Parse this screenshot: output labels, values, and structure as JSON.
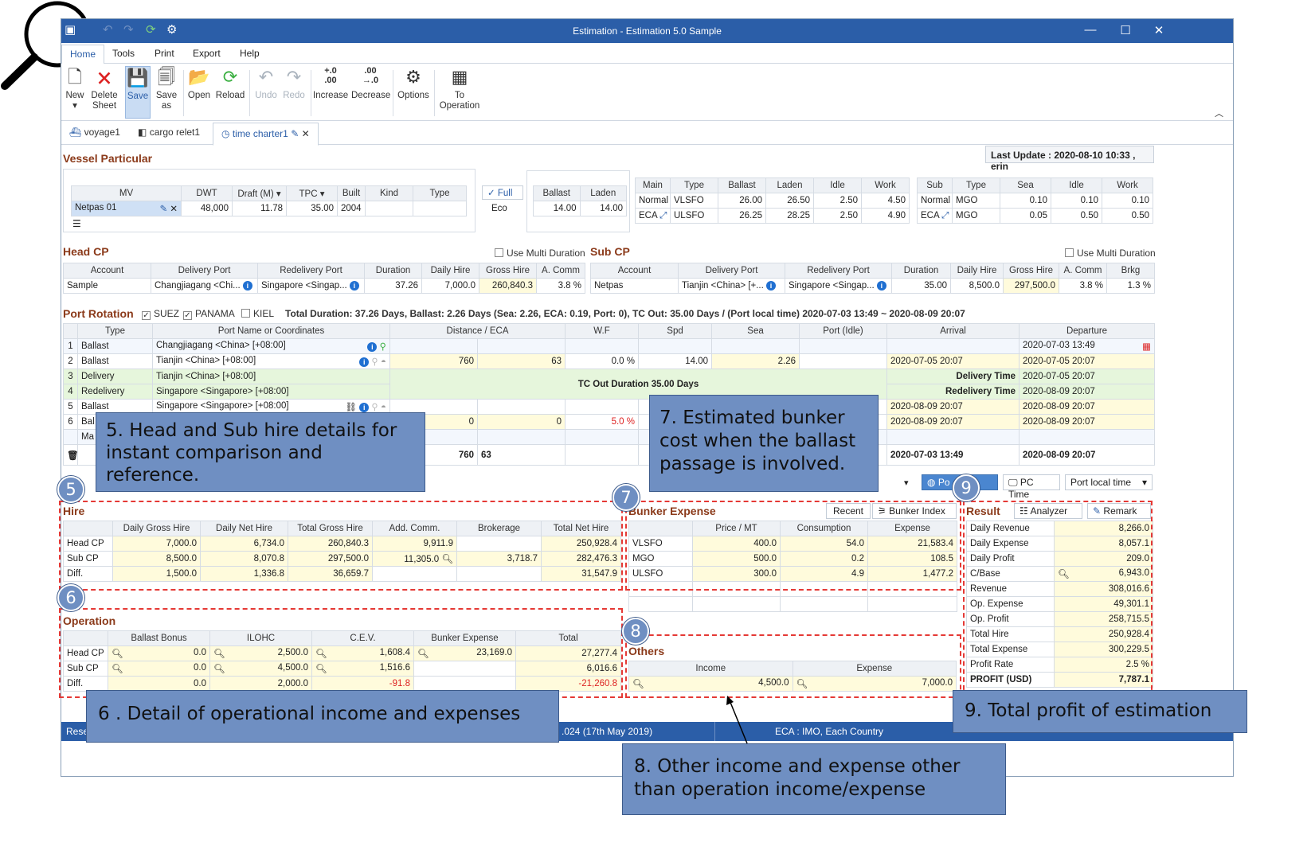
{
  "window": {
    "title": "Estimation - Estimation 5.0 Sample"
  },
  "menu": [
    "Home",
    "Tools",
    "Print",
    "Export",
    "Help"
  ],
  "ribbon": {
    "new": "New",
    "delete": "Delete",
    "delete2": "Sheet",
    "save": "Save",
    "saveas": "Save",
    "saveas2": "as",
    "open": "Open",
    "reload": "Reload",
    "undo": "Undo",
    "redo": "Redo",
    "increase": "Increase",
    "increase_ic": "+.0\n.00",
    "decrease": "Decrease",
    "decrease_ic": ".00\n→.0",
    "options": "Options",
    "to": "To",
    "operation": "Operation"
  },
  "tabs": [
    "voyage1",
    "cargo relet1",
    "time charter1"
  ],
  "last_update": "Last Update : 2020-08-10 10:33 , erin",
  "vessel": {
    "title": "Vessel Particular",
    "headers": [
      "MV",
      "DWT",
      "Draft (M)",
      "TPC",
      "Built",
      "Kind",
      "Type"
    ],
    "row": [
      "Netpas 01",
      "48,000",
      "11.78",
      "35.00",
      "2004",
      "",
      ""
    ],
    "full": "Full",
    "eco": "Eco",
    "speed_headers": [
      "Ballast",
      "Laden"
    ],
    "speed": [
      "14.00",
      "14.00"
    ],
    "main_headers": [
      "Main",
      "Type",
      "Ballast",
      "Laden",
      "Idle",
      "Work"
    ],
    "main_rows": [
      [
        "Normal",
        "VLSFO",
        "26.00",
        "26.50",
        "2.50",
        "4.50"
      ],
      [
        "ECA",
        "ULSFO",
        "26.25",
        "28.25",
        "2.50",
        "4.90"
      ]
    ],
    "sub_headers": [
      "Sub",
      "Type",
      "Sea",
      "Idle",
      "Work"
    ],
    "sub_rows": [
      [
        "Normal",
        "MGO",
        "0.10",
        "0.10",
        "0.10"
      ],
      [
        "ECA",
        "MGO",
        "0.05",
        "0.50",
        "0.50"
      ]
    ]
  },
  "head_cp": {
    "title": "Head CP",
    "multi": "Use Multi Duration",
    "headers": [
      "Account",
      "Delivery Port",
      "Redelivery Port",
      "Duration",
      "Daily Hire",
      "Gross Hire",
      "A. Comm"
    ],
    "row": [
      "Sample",
      "Changjiagang <Chi...",
      "Singapore <Singap...",
      "37.26",
      "7,000.0",
      "260,840.3",
      "3.8 %"
    ]
  },
  "sub_cp": {
    "title": "Sub CP",
    "multi": "Use Multi Duration",
    "headers": [
      "Account",
      "Delivery Port",
      "Redelivery Port",
      "Duration",
      "Daily Hire",
      "Gross Hire",
      "A. Comm",
      "Brkg"
    ],
    "row": [
      "Netpas",
      "Tianjin <China> [+...",
      "Singapore <Singap...",
      "35.00",
      "8,500.0",
      "297,500.0",
      "3.8 %",
      "1.3 %"
    ]
  },
  "port_rotation": {
    "title": "Port Rotation",
    "suez": "SUEZ",
    "panama": "PANAMA",
    "kiel": "KIEL",
    "summary": "Total Duration: 37.26 Days, Ballast: 2.26 Days (Sea: 2.26, ECA: 0.19, Port: 0), TC Out: 35.00 Days / (Port local time) 2020-07-03 13:49 ~ 2020-08-09 20:07",
    "headers": [
      "",
      "Type",
      "Port Name or Coordinates",
      "Distance / ECA",
      "W.F",
      "Spd",
      "Sea",
      "Port (Idle)",
      "Arrival",
      "Departure"
    ],
    "rows": [
      [
        "1",
        "Ballast",
        "Changjiagang <China> [+08:00]",
        "",
        "",
        "",
        "",
        "",
        "",
        "",
        "2020-07-03 13:49"
      ],
      [
        "2",
        "Ballast",
        "Tianjin <China> [+08:00]",
        "760",
        "63",
        "0.0 %",
        "14.00",
        "2.26",
        "",
        "2020-07-05 20:07",
        "2020-07-05 20:07"
      ],
      [
        "3",
        "Delivery",
        "Tianjin <China> [+08:00]",
        "",
        "",
        "",
        "",
        "",
        "",
        "Delivery Time",
        "2020-07-05 20:07"
      ],
      [
        "4",
        "Redelivery",
        "Singapore <Singapore> [+08:00]",
        "",
        "",
        "",
        "",
        "",
        "",
        "Redelivery Time",
        "2020-08-09 20:07"
      ],
      [
        "5",
        "Ballast",
        "Singapore <Singapore> [+08:00]",
        "",
        "",
        "",
        "",
        "",
        "",
        "2020-08-09 20:07",
        "2020-08-09 20:07"
      ],
      [
        "6",
        "Bal",
        "",
        "0",
        "0",
        "5.0 %",
        "",
        "",
        "",
        "2020-08-09 20:07",
        "2020-08-09 20:07"
      ],
      [
        "",
        "Ma",
        "",
        "",
        "",
        "",
        "",
        "",
        "",
        "",
        ""
      ]
    ],
    "tc_out": "TC Out Duration 35.00 Days",
    "total_dist": "760",
    "total_eca": "63",
    "total_arr": "2020-07-03 13:49",
    "total_dep": "2020-08-09 20:07",
    "pc_time": "PC Time",
    "port_local": "Port local time",
    "port_btn": "Po",
    "port_btn2": "al"
  },
  "hire": {
    "title": "Hire",
    "headers": [
      "",
      "Daily Gross Hire",
      "Daily Net Hire",
      "Total Gross Hire",
      "Add. Comm.",
      "Brokerage",
      "Total Net Hire"
    ],
    "rows": [
      [
        "Head CP",
        "7,000.0",
        "6,734.0",
        "260,840.3",
        "9,911.9",
        "",
        "250,928.4"
      ],
      [
        "Sub CP",
        "8,500.0",
        "8,070.8",
        "297,500.0",
        "11,305.0",
        "3,718.7",
        "282,476.3"
      ],
      [
        "Diff.",
        "1,500.0",
        "1,336.8",
        "36,659.7",
        "",
        "",
        "31,547.9"
      ]
    ]
  },
  "operation": {
    "title": "Operation",
    "headers": [
      "",
      "Ballast Bonus",
      "ILOHC",
      "C.E.V.",
      "Bunker Expense",
      "Total"
    ],
    "rows": [
      [
        "Head CP",
        "0.0",
        "2,500.0",
        "1,608.4",
        "23,169.0",
        "27,277.4"
      ],
      [
        "Sub CP",
        "0.0",
        "4,500.0",
        "1,516.6",
        "",
        "6,016.6"
      ],
      [
        "Diff.",
        "0.0",
        "2,000.0",
        "-91.8",
        "",
        "-21,260.8"
      ]
    ]
  },
  "bunker": {
    "title": "Bunker Expense",
    "recent": "Recent",
    "index": "Bunker Index",
    "headers": [
      "",
      "Price / MT",
      "Consumption",
      "Expense"
    ],
    "rows": [
      [
        "VLSFO",
        "400.0",
        "54.0",
        "21,583.4"
      ],
      [
        "MGO",
        "500.0",
        "0.2",
        "108.5"
      ],
      [
        "ULSFO",
        "300.0",
        "4.9",
        "1,477.2"
      ]
    ]
  },
  "others": {
    "title": "Others",
    "headers": [
      "Income",
      "Expense"
    ],
    "row": [
      "4,500.0",
      "7,000.0"
    ]
  },
  "result": {
    "title": "Result",
    "analyzer": "Analyzer",
    "remark": "Remark",
    "rows": [
      [
        "Daily Revenue",
        "8,266.0"
      ],
      [
        "Daily Expense",
        "8,057.1"
      ],
      [
        "Daily Profit",
        "209.0"
      ],
      [
        "C/Base",
        "6,943.0"
      ],
      [
        "Revenue",
        "308,016.6"
      ],
      [
        "Op. Expense",
        "49,301.1"
      ],
      [
        "Op. Profit",
        "258,715.5"
      ],
      [
        "Total Hire",
        "250,928.4"
      ],
      [
        "Total Expense",
        "300,229.5"
      ],
      [
        "Profit Rate",
        "2.5 %"
      ],
      [
        "PROFIT (USD)",
        "7,787.1"
      ]
    ]
  },
  "status": {
    "reset": "Reset",
    "middle": ".024 (17th May 2019)",
    "eca": "ECA : IMO, Each Country"
  },
  "callouts": {
    "c5": "5.  Head and Sub hire details for instant comparison and reference.",
    "c6": "6 . Detail of operational income and expenses",
    "c7": "7. Estimated bunker cost when the ballast passage is involved.",
    "c8": "8. Other income and expense other than operation income/expense",
    "c9": "9. Total profit of estimation",
    "n5": "5",
    "n6": "6",
    "n7": "7",
    "n8": "8",
    "n9": "9"
  }
}
